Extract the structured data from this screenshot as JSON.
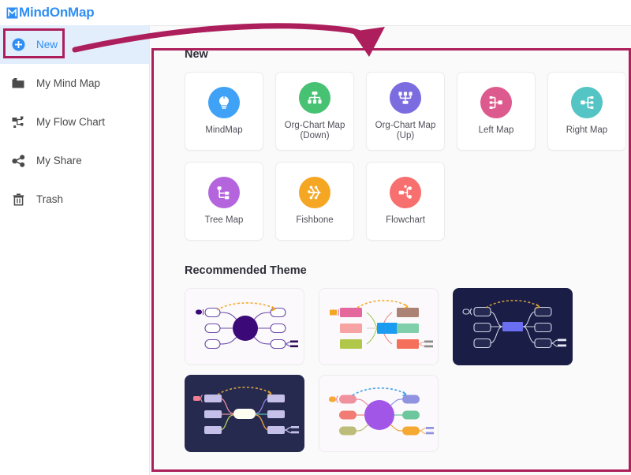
{
  "brand": {
    "name": "MindOnMap",
    "logo_icon": "m-letter-icon",
    "color": "#2f8ef4"
  },
  "sidebar": {
    "items": [
      {
        "label": "New",
        "icon": "plus-circle-icon",
        "active": true,
        "highlighted": true
      },
      {
        "label": "My Mind Map",
        "icon": "folder-icon",
        "active": false,
        "highlighted": false
      },
      {
        "label": "My Flow Chart",
        "icon": "flowchart-icon",
        "active": false,
        "highlighted": false
      },
      {
        "label": "My Share",
        "icon": "share-icon",
        "active": false,
        "highlighted": false
      },
      {
        "label": "Trash",
        "icon": "trash-icon",
        "active": false,
        "highlighted": false
      }
    ]
  },
  "main": {
    "new_section": {
      "title": "New",
      "cards": [
        {
          "label": "MindMap",
          "icon": "lightbulb-icon",
          "color": "#3fa2f7"
        },
        {
          "label": "Org-Chart Map (Down)",
          "icon": "org-chart-down-icon",
          "color": "#46c272"
        },
        {
          "label": "Org-Chart Map (Up)",
          "icon": "org-chart-up-icon",
          "color": "#7b6ce0"
        },
        {
          "label": "Left Map",
          "icon": "left-map-icon",
          "color": "#dd5a8e"
        },
        {
          "label": "Right Map",
          "icon": "right-map-icon",
          "color": "#54c4c4"
        },
        {
          "label": "Tree Map",
          "icon": "tree-map-icon",
          "color": "#b465de"
        },
        {
          "label": "Fishbone",
          "icon": "fishbone-icon",
          "color": "#f5a623"
        },
        {
          "label": "Flowchart",
          "icon": "flowchart-card-icon",
          "color": "#f76f6f"
        }
      ]
    },
    "recommended_section": {
      "title": "Recommended Theme",
      "themes": [
        {
          "name": "theme-purple-light",
          "style": "light",
          "center_color": "#3b0a78",
          "arrow_color": "#f5a623"
        },
        {
          "name": "theme-colorful-light",
          "style": "light",
          "center_color": "#1b9cf0",
          "arrow_color": "#f5a623"
        },
        {
          "name": "theme-navy-blue",
          "style": "dark",
          "center_color": "#6a6ef0",
          "arrow_color": "#d8a13c"
        },
        {
          "name": "theme-navy-white",
          "style": "dark2",
          "center_color": "#fdfdf6",
          "arrow_color": "#d8a13c"
        },
        {
          "name": "theme-violet-light",
          "style": "light",
          "center_color": "#a256e8",
          "arrow_color": "#3fa0e8"
        }
      ]
    }
  },
  "annotation": {
    "color": "#ad1f5c",
    "arrow": "curved-arrow-pointing-to-content-panel",
    "highlight_box": "new-button-highlight"
  }
}
